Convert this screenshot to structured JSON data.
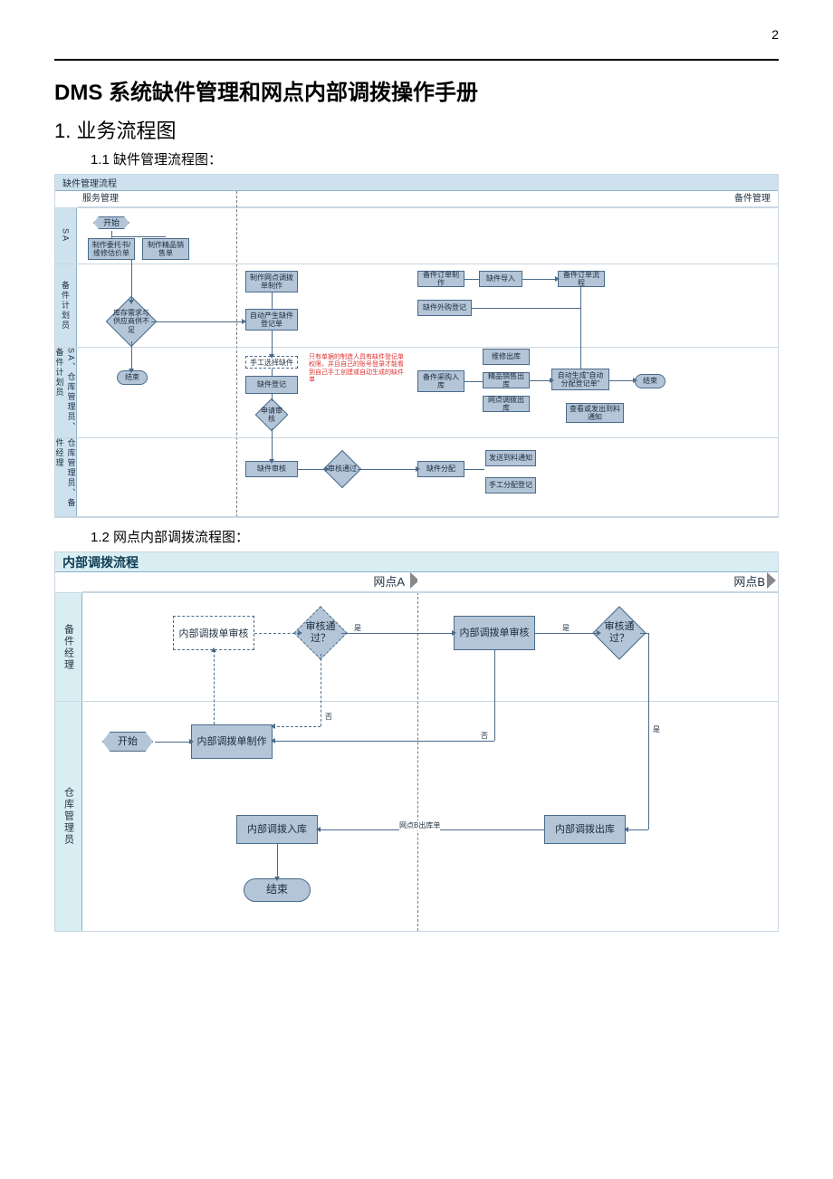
{
  "page_number": "2",
  "doc_title": "DMS 系统缺件管理和网点内部调拨操作手册",
  "section1": "1. 业务流程图",
  "sub_1_1": "1.1 缺件管理流程图：",
  "sub_1_2": "1.2 网点内部调拨流程图：",
  "d1": {
    "title": "缺件管理流程",
    "col_service": "服务管理",
    "col_spare": "备件管理",
    "lane_SA": "SA",
    "lane_plan": "备件计划员",
    "lane_SA_mgr": "SA、仓库管理员、备件计划员",
    "lane_wh": "仓库管理员、备件经理",
    "start": "开始",
    "n_wt": "制作委托书/维修估价单",
    "n_jp": "制作精品销售单",
    "n_wd": "制作网点调拨单制作",
    "d_stock": "库存需求与供应商供不足",
    "n_auto": "自动产生缺件登记单",
    "end1": "结束",
    "dash_manual": "手工选择缺件",
    "n_qjdj": "缺件登记",
    "red_note": "只有单据的制造人具有缺件登记单权限，并且自己的账号登录才能看到自己手工创建或自动生成的缺件单",
    "d_apply": "申请审核",
    "n_audit": "缺件审核",
    "d_pass": "审核通过",
    "n_order": "备件订单制作",
    "n_import": "缺件导入",
    "n_ext": "缺件外购登记",
    "n_flow": "备件订单流程",
    "n_in": "备件采购入库",
    "n_wxout": "维修出库",
    "n_jpout": "精品销售出库",
    "n_wdout": "网点调拨出库",
    "n_autodist": "自动生成\"自动分配登记单\"",
    "end2": "结束",
    "n_view": "查看或发出到料通知",
    "n_dist": "缺件分配",
    "n_notify": "发送到料通知",
    "n_manual": "手工分配登记"
  },
  "d2": {
    "title": "内部调拨流程",
    "col_a": "网点A",
    "col_b": "网点B",
    "lane_mgr": "备件经理",
    "lane_wh": "仓库管理员",
    "start": "开始",
    "n_make": "内部调拨单制作",
    "n_audit_a": "内部调拨单审核",
    "d_pass_a": "审核通过？",
    "n_audit_b": "内部调拨单审核",
    "d_pass_b": "审核通过？",
    "n_out": "内部调拨出库",
    "n_in": "内部调拨入库",
    "end": "结束",
    "lbl_yes": "是",
    "lbl_no": "否",
    "lbl_sheet": "网点B出库单"
  }
}
